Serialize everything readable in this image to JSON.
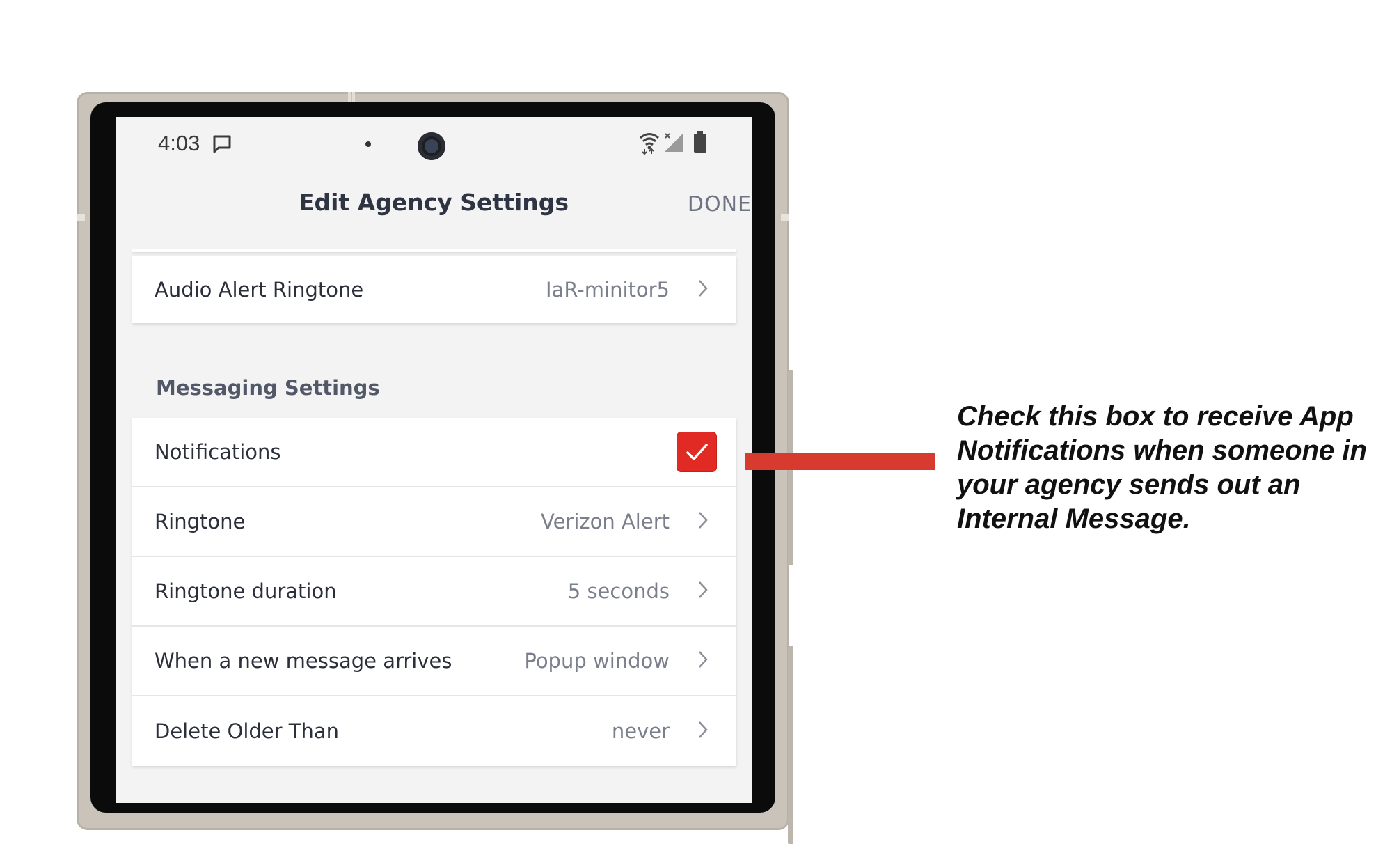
{
  "status_bar": {
    "time": "4:03",
    "icons": [
      "message-icon",
      "wifi-icon",
      "signal-icon",
      "battery-icon"
    ]
  },
  "header": {
    "title": "Edit Agency Settings",
    "done_label": "DONE"
  },
  "audio_alert": {
    "label": "Audio Alert Ringtone",
    "value": "IaR-minitor5"
  },
  "messaging": {
    "section_title": "Messaging Settings",
    "notifications": {
      "label": "Notifications",
      "checked": true
    },
    "ringtone": {
      "label": "Ringtone",
      "value": "Verizon Alert"
    },
    "ringtone_duration": {
      "label": "Ringtone duration",
      "value": "5 seconds"
    },
    "new_message": {
      "label": "When a new message arrives",
      "value": "Popup window"
    },
    "delete_older": {
      "label": "Delete Older Than",
      "value": "never"
    }
  },
  "annotation": {
    "text": "Check this box to receive App Notifications when someone in your agency sends out an Internal Message.",
    "color": "#d73a2e"
  },
  "colors": {
    "checkbox": "#e02a23",
    "screen_background": "#f3f3f3"
  }
}
